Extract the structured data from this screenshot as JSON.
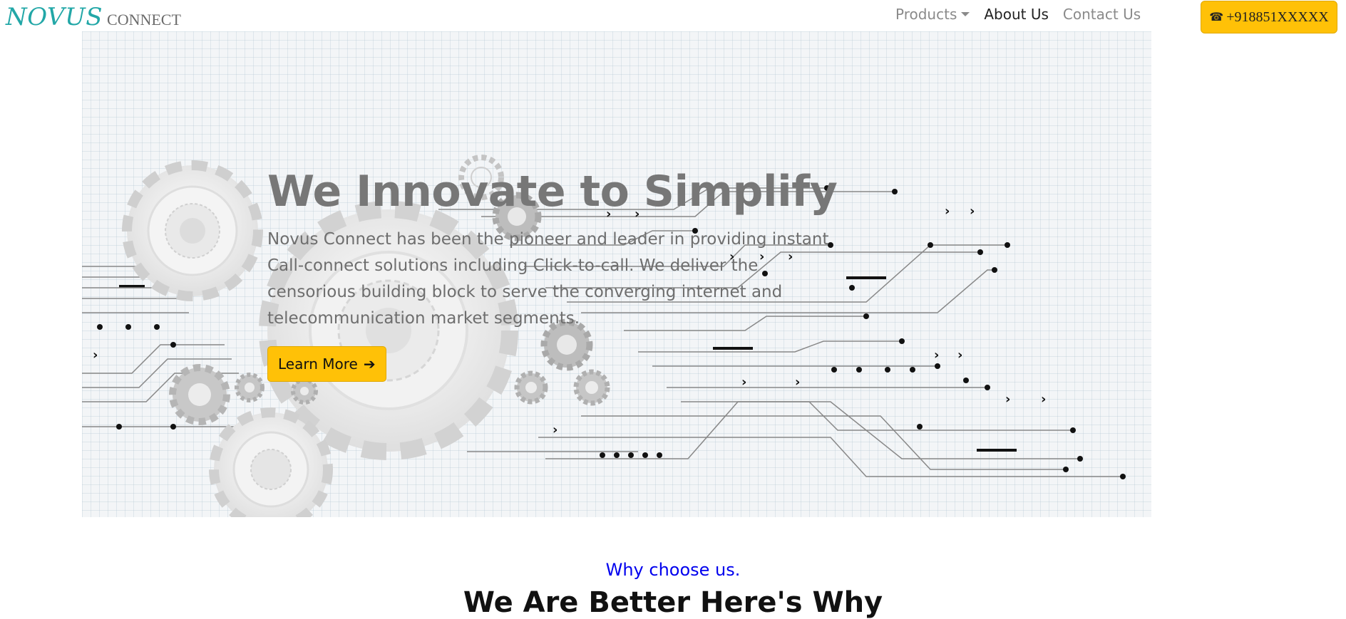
{
  "brand": {
    "main": "NOVUS",
    "sub": "CONNECT"
  },
  "nav": {
    "items": [
      {
        "label": "Products",
        "has_dropdown": true,
        "active": false
      },
      {
        "label": "About Us",
        "has_dropdown": false,
        "active": true
      },
      {
        "label": "Contact Us",
        "has_dropdown": false,
        "active": false
      }
    ]
  },
  "phone": {
    "icon": "phone-icon",
    "number": "+918851XXXXX"
  },
  "hero": {
    "title": "We Innovate to Simplify",
    "text": "Novus Connect has been the pioneer and leader in providing instant Call-connect solutions including Click-to-call. We deliver the censorious building block to serve the converging internet and telecommunication market segments.",
    "cta_label": "Learn More",
    "cta_icon": "arrow-right-icon"
  },
  "section": {
    "eyebrow": "Why choose us.",
    "heading": "We Are Better Here's Why"
  },
  "colors": {
    "accent": "#ffc107",
    "brand": "#22a7a7",
    "link": "#0000ee"
  }
}
